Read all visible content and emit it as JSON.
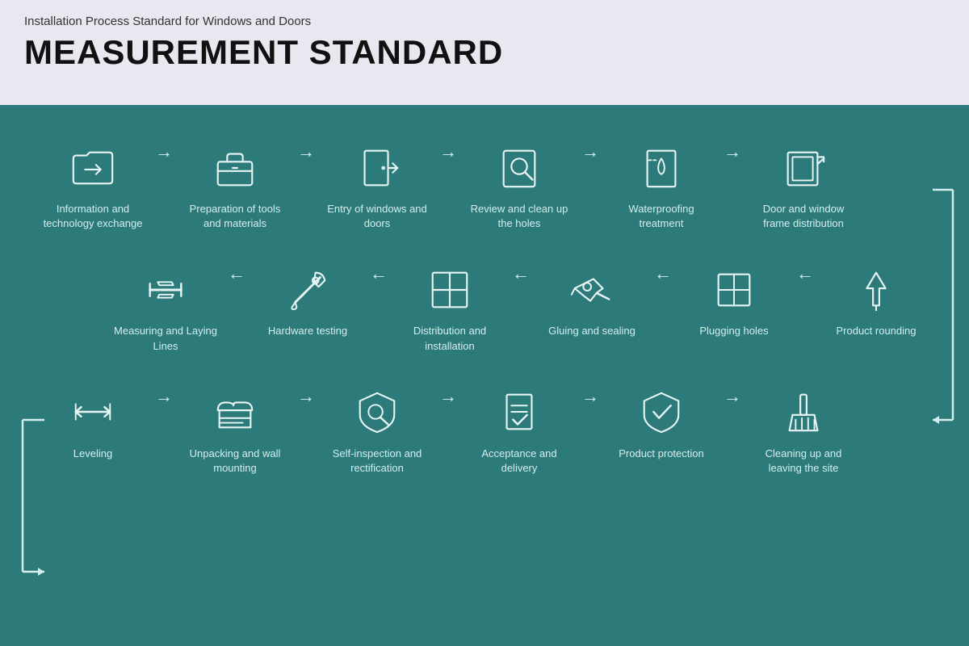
{
  "header": {
    "subtitle": "Installation Process Standard for Windows and Doors",
    "title": "MEASUREMENT STANDARD"
  },
  "colors": {
    "header_bg": "#e8e8f0",
    "main_bg": "#2d7a7a",
    "icon_stroke": "#d4f0f0",
    "text_color": "#d4eeed",
    "arrow_color": "#d4eeed"
  },
  "rows": [
    {
      "id": "row1",
      "direction": "right",
      "steps": [
        {
          "id": "step-info",
          "label": "Information and technology exchange",
          "icon": "folder"
        },
        {
          "id": "step-tools",
          "label": "Preparation of tools and materials",
          "icon": "toolbox"
        },
        {
          "id": "step-entry",
          "label": "Entry of windows and doors",
          "icon": "door-entry"
        },
        {
          "id": "step-review",
          "label": "Review and clean up the holes",
          "icon": "search"
        },
        {
          "id": "step-waterproof",
          "label": "Waterproofing treatment",
          "icon": "waterproof"
        },
        {
          "id": "step-frame",
          "label": "Door and window frame distribution",
          "icon": "frame"
        }
      ]
    },
    {
      "id": "row2",
      "direction": "left",
      "steps": [
        {
          "id": "step-measuring",
          "label": "Measuring and Laying Lines",
          "icon": "measure"
        },
        {
          "id": "step-hardware",
          "label": "Hardware testing",
          "icon": "hardware"
        },
        {
          "id": "step-distribution",
          "label": "Distribution and installation",
          "icon": "distribute"
        },
        {
          "id": "step-gluing",
          "label": "Gluing and sealing",
          "icon": "glue"
        },
        {
          "id": "step-plugging",
          "label": "Plugging holes",
          "icon": "plug"
        },
        {
          "id": "step-rounding",
          "label": "Product rounding",
          "icon": "round"
        }
      ]
    },
    {
      "id": "row3",
      "direction": "right",
      "steps": [
        {
          "id": "step-leveling",
          "label": "Leveling",
          "icon": "level"
        },
        {
          "id": "step-unpacking",
          "label": "Unpacking and wall mounting",
          "icon": "unpack"
        },
        {
          "id": "step-self-inspect",
          "label": "Self-inspection and rectification",
          "icon": "inspect"
        },
        {
          "id": "step-acceptance",
          "label": "Acceptance and delivery",
          "icon": "accept"
        },
        {
          "id": "step-protection",
          "label": "Product protection",
          "icon": "protect"
        },
        {
          "id": "step-cleaning",
          "label": "Cleaning up and leaving the site",
          "icon": "clean"
        }
      ]
    }
  ]
}
